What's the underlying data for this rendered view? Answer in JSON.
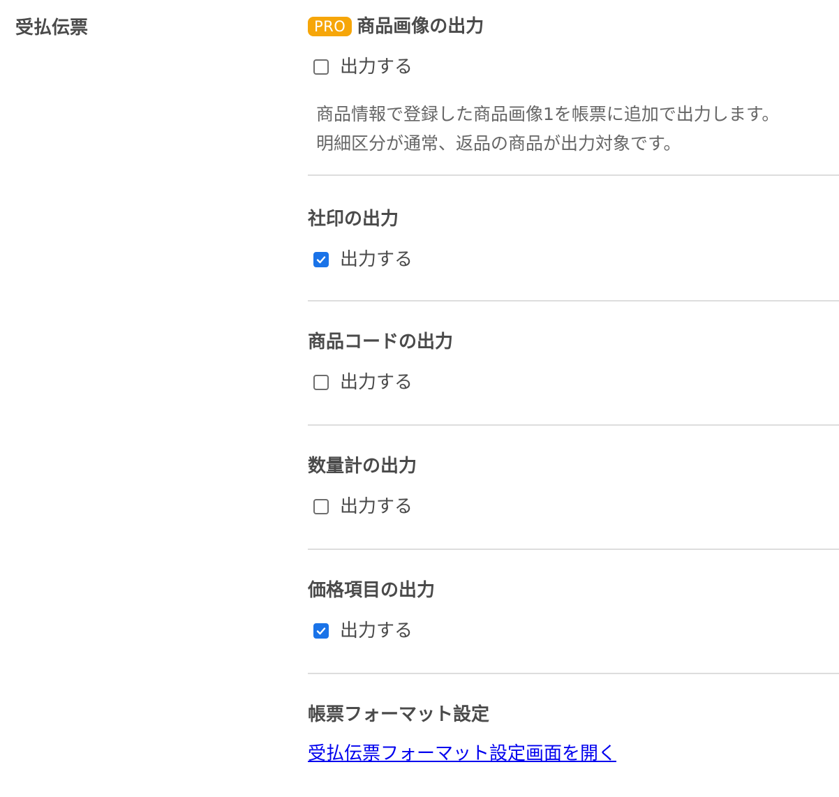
{
  "page": {
    "row_label": "受払伝票"
  },
  "sections": [
    {
      "title": "商品画像の出力",
      "badge": "PRO",
      "checkbox_label": "出力する",
      "checked": false,
      "description": [
        "商品情報で登録した商品画像1を帳票に追加で出力します。",
        "明細区分が通常、返品の商品が出力対象です。"
      ]
    },
    {
      "title": "社印の出力",
      "checkbox_label": "出力する",
      "checked": true
    },
    {
      "title": "商品コードの出力",
      "checkbox_label": "出力する",
      "checked": false
    },
    {
      "title": "数量計の出力",
      "checkbox_label": "出力する",
      "checked": false
    },
    {
      "title": "価格項目の出力",
      "checkbox_label": "出力する",
      "checked": true
    }
  ],
  "format_settings": {
    "title": "帳票フォーマット設定",
    "link_text": "受払伝票フォーマット設定画面を開く"
  },
  "colors": {
    "badge": "#f6a609",
    "checkbox_checked": "#1a73e8",
    "link": "#0000ee",
    "divider": "#dddddd"
  }
}
